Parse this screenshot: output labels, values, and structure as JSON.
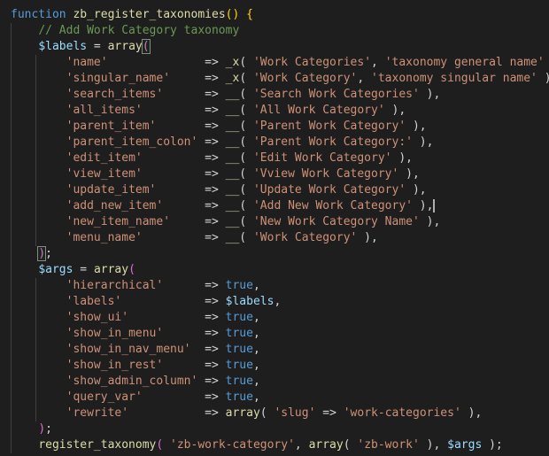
{
  "colors": {
    "background": "#1e1e1e",
    "keyword": "#569cd6",
    "function": "#dcdcaa",
    "variable": "#9cdcfe",
    "string": "#ce9178",
    "comment": "#6a9955",
    "text": "#d4d4d4",
    "bracket_level1": "#ffd700",
    "bracket_level2": "#da70d6",
    "indent_guide": "#404040"
  },
  "code_lines": [
    {
      "indent": 0,
      "tokens": [
        {
          "t": "function",
          "c": "kw"
        },
        {
          "t": " ",
          "c": "op"
        },
        {
          "t": "zb_register_taxonomies",
          "c": "fn"
        },
        {
          "t": "()",
          "c": "brk-y"
        },
        {
          "t": " ",
          "c": "op"
        },
        {
          "t": "{",
          "c": "brk-y"
        }
      ]
    },
    {
      "indent": 1,
      "tokens": [
        {
          "t": "// Add Work Category taxonomy",
          "c": "cmt"
        }
      ]
    },
    {
      "indent": 1,
      "tokens": [
        {
          "t": "$labels",
          "c": "var"
        },
        {
          "t": " = ",
          "c": "op"
        },
        {
          "t": "array",
          "c": "fn"
        },
        {
          "t": "(",
          "c": "brk-p",
          "match": true
        }
      ]
    },
    {
      "indent": 2,
      "tokens": [
        {
          "t": "'name'",
          "c": "str"
        },
        {
          "t": "              => ",
          "c": "op"
        },
        {
          "t": "_x",
          "c": "fn"
        },
        {
          "t": "( ",
          "c": "op"
        },
        {
          "t": "'Work Categories'",
          "c": "str"
        },
        {
          "t": ", ",
          "c": "op"
        },
        {
          "t": "'taxonomy general name'",
          "c": "str"
        },
        {
          "t": " ),",
          "c": "op"
        }
      ]
    },
    {
      "indent": 2,
      "tokens": [
        {
          "t": "'singular_name'",
          "c": "str"
        },
        {
          "t": "     => ",
          "c": "op"
        },
        {
          "t": "_x",
          "c": "fn"
        },
        {
          "t": "( ",
          "c": "op"
        },
        {
          "t": "'Work Category'",
          "c": "str"
        },
        {
          "t": ", ",
          "c": "op"
        },
        {
          "t": "'taxonomy singular name'",
          "c": "str"
        },
        {
          "t": " ),",
          "c": "op"
        }
      ]
    },
    {
      "indent": 2,
      "tokens": [
        {
          "t": "'search_items'",
          "c": "str"
        },
        {
          "t": "      => ",
          "c": "op"
        },
        {
          "t": "__",
          "c": "fn"
        },
        {
          "t": "( ",
          "c": "op"
        },
        {
          "t": "'Search Work Categories'",
          "c": "str"
        },
        {
          "t": " ),",
          "c": "op"
        }
      ]
    },
    {
      "indent": 2,
      "tokens": [
        {
          "t": "'all_items'",
          "c": "str"
        },
        {
          "t": "         => ",
          "c": "op"
        },
        {
          "t": "__",
          "c": "fn"
        },
        {
          "t": "( ",
          "c": "op"
        },
        {
          "t": "'All Work Category'",
          "c": "str"
        },
        {
          "t": " ),",
          "c": "op"
        }
      ]
    },
    {
      "indent": 2,
      "tokens": [
        {
          "t": "'parent_item'",
          "c": "str"
        },
        {
          "t": "       => ",
          "c": "op"
        },
        {
          "t": "__",
          "c": "fn"
        },
        {
          "t": "( ",
          "c": "op"
        },
        {
          "t": "'Parent Work Category'",
          "c": "str"
        },
        {
          "t": " ),",
          "c": "op"
        }
      ]
    },
    {
      "indent": 2,
      "tokens": [
        {
          "t": "'parent_item_colon'",
          "c": "str"
        },
        {
          "t": " => ",
          "c": "op"
        },
        {
          "t": "__",
          "c": "fn"
        },
        {
          "t": "( ",
          "c": "op"
        },
        {
          "t": "'Parent Work Category:'",
          "c": "str"
        },
        {
          "t": " ),",
          "c": "op"
        }
      ]
    },
    {
      "indent": 2,
      "tokens": [
        {
          "t": "'edit_item'",
          "c": "str"
        },
        {
          "t": "         => ",
          "c": "op"
        },
        {
          "t": "__",
          "c": "fn"
        },
        {
          "t": "( ",
          "c": "op"
        },
        {
          "t": "'Edit Work Category'",
          "c": "str"
        },
        {
          "t": " ),",
          "c": "op"
        }
      ]
    },
    {
      "indent": 2,
      "tokens": [
        {
          "t": "'view_item'",
          "c": "str"
        },
        {
          "t": "         => ",
          "c": "op"
        },
        {
          "t": "__",
          "c": "fn"
        },
        {
          "t": "( ",
          "c": "op"
        },
        {
          "t": "'Vview Work Category'",
          "c": "str"
        },
        {
          "t": " ),",
          "c": "op"
        }
      ]
    },
    {
      "indent": 2,
      "tokens": [
        {
          "t": "'update_item'",
          "c": "str"
        },
        {
          "t": "       => ",
          "c": "op"
        },
        {
          "t": "__",
          "c": "fn"
        },
        {
          "t": "( ",
          "c": "op"
        },
        {
          "t": "'Update Work Category'",
          "c": "str"
        },
        {
          "t": " ),",
          "c": "op"
        }
      ]
    },
    {
      "indent": 2,
      "cursor": true,
      "tokens": [
        {
          "t": "'add_new_item'",
          "c": "str"
        },
        {
          "t": "      => ",
          "c": "op"
        },
        {
          "t": "__",
          "c": "fn"
        },
        {
          "t": "( ",
          "c": "op"
        },
        {
          "t": "'Add New Work Category'",
          "c": "str"
        },
        {
          "t": " ),",
          "c": "op"
        }
      ]
    },
    {
      "indent": 2,
      "tokens": [
        {
          "t": "'new_item_name'",
          "c": "str"
        },
        {
          "t": "     => ",
          "c": "op"
        },
        {
          "t": "__",
          "c": "fn"
        },
        {
          "t": "( ",
          "c": "op"
        },
        {
          "t": "'New Work Category Name'",
          "c": "str"
        },
        {
          "t": " ),",
          "c": "op"
        }
      ]
    },
    {
      "indent": 2,
      "tokens": [
        {
          "t": "'menu_name'",
          "c": "str"
        },
        {
          "t": "         => ",
          "c": "op"
        },
        {
          "t": "__",
          "c": "fn"
        },
        {
          "t": "( ",
          "c": "op"
        },
        {
          "t": "'Work Category'",
          "c": "str"
        },
        {
          "t": " ),",
          "c": "op"
        }
      ]
    },
    {
      "indent": 1,
      "tokens": [
        {
          "t": ")",
          "c": "brk-p",
          "match": true
        },
        {
          "t": ";",
          "c": "op"
        }
      ]
    },
    {
      "indent": 1,
      "tokens": [
        {
          "t": "$args",
          "c": "var"
        },
        {
          "t": " = ",
          "c": "op"
        },
        {
          "t": "array",
          "c": "fn"
        },
        {
          "t": "(",
          "c": "brk-p"
        }
      ]
    },
    {
      "indent": 2,
      "tokens": [
        {
          "t": "'hierarchical'",
          "c": "str"
        },
        {
          "t": "      => ",
          "c": "op"
        },
        {
          "t": "true",
          "c": "bool"
        },
        {
          "t": ",",
          "c": "op"
        }
      ]
    },
    {
      "indent": 2,
      "tokens": [
        {
          "t": "'labels'",
          "c": "str"
        },
        {
          "t": "            => ",
          "c": "op"
        },
        {
          "t": "$labels",
          "c": "var"
        },
        {
          "t": ",",
          "c": "op"
        }
      ]
    },
    {
      "indent": 2,
      "tokens": [
        {
          "t": "'show_ui'",
          "c": "str"
        },
        {
          "t": "           => ",
          "c": "op"
        },
        {
          "t": "true",
          "c": "bool"
        },
        {
          "t": ",",
          "c": "op"
        }
      ]
    },
    {
      "indent": 2,
      "tokens": [
        {
          "t": "'show_in_menu'",
          "c": "str"
        },
        {
          "t": "      => ",
          "c": "op"
        },
        {
          "t": "true",
          "c": "bool"
        },
        {
          "t": ",",
          "c": "op"
        }
      ]
    },
    {
      "indent": 2,
      "tokens": [
        {
          "t": "'show_in_nav_menu'",
          "c": "str"
        },
        {
          "t": "  => ",
          "c": "op"
        },
        {
          "t": "true",
          "c": "bool"
        },
        {
          "t": ",",
          "c": "op"
        }
      ]
    },
    {
      "indent": 2,
      "tokens": [
        {
          "t": "'show_in_rest'",
          "c": "str"
        },
        {
          "t": "      => ",
          "c": "op"
        },
        {
          "t": "true",
          "c": "bool"
        },
        {
          "t": ",",
          "c": "op"
        }
      ]
    },
    {
      "indent": 2,
      "tokens": [
        {
          "t": "'show_admin_column'",
          "c": "str"
        },
        {
          "t": " => ",
          "c": "op"
        },
        {
          "t": "true",
          "c": "bool"
        },
        {
          "t": ",",
          "c": "op"
        }
      ]
    },
    {
      "indent": 2,
      "tokens": [
        {
          "t": "'query_var'",
          "c": "str"
        },
        {
          "t": "         => ",
          "c": "op"
        },
        {
          "t": "true",
          "c": "bool"
        },
        {
          "t": ",",
          "c": "op"
        }
      ]
    },
    {
      "indent": 2,
      "tokens": [
        {
          "t": "'rewrite'",
          "c": "str"
        },
        {
          "t": "           => ",
          "c": "op"
        },
        {
          "t": "array",
          "c": "fn"
        },
        {
          "t": "( ",
          "c": "op"
        },
        {
          "t": "'slug'",
          "c": "str"
        },
        {
          "t": " => ",
          "c": "op"
        },
        {
          "t": "'work-categories'",
          "c": "str"
        },
        {
          "t": " ),",
          "c": "op"
        }
      ]
    },
    {
      "indent": 1,
      "tokens": [
        {
          "t": ")",
          "c": "brk-p"
        },
        {
          "t": ";",
          "c": "op"
        }
      ]
    },
    {
      "indent": 1,
      "tokens": [
        {
          "t": "register_taxonomy",
          "c": "fn"
        },
        {
          "t": "( ",
          "c": "brk-p"
        },
        {
          "t": "'zb-work-category'",
          "c": "str"
        },
        {
          "t": ", ",
          "c": "op"
        },
        {
          "t": "array",
          "c": "fn"
        },
        {
          "t": "( ",
          "c": "op"
        },
        {
          "t": "'zb-work'",
          "c": "str"
        },
        {
          "t": " ), ",
          "c": "op"
        },
        {
          "t": "$args",
          "c": "var"
        },
        {
          "t": " );",
          "c": "op"
        }
      ]
    }
  ]
}
